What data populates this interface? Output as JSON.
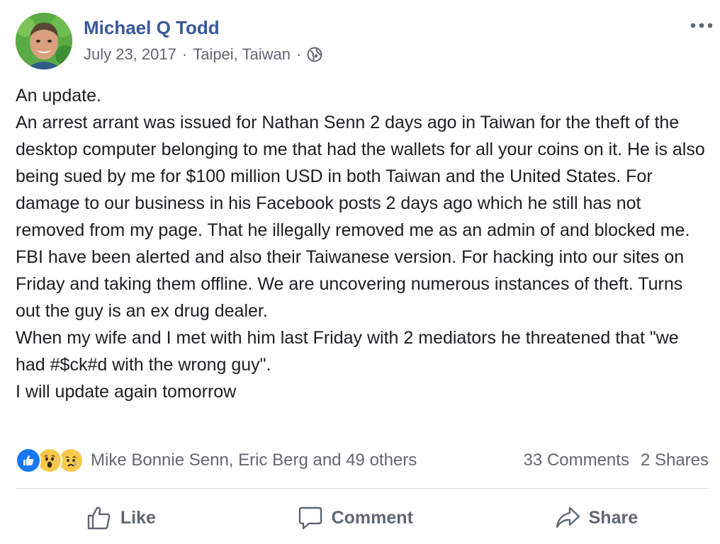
{
  "post": {
    "author": "Michael Q Todd",
    "date": "July 23, 2017",
    "location": "Taipei, Taiwan",
    "separator": "·",
    "icons": {
      "avatar": "profile-photo",
      "audience": "globe-icon",
      "menu": "more-options-icon"
    },
    "lines": [
      "An update.",
      "An arrest arrant was issued for Nathan Senn 2 days ago in Taiwan for the theft of the desktop computer belonging to me that had the wallets for all your coins on it. He is also being sued by me for $100 million USD in both Taiwan and the United States. For damage to our business in his Facebook posts 2 days ago which he still has not removed from my page. That he illegally removed me as an admin of and blocked me.",
      "FBI have been alerted and also their Taiwanese version. For hacking into our sites on Friday and taking them offline. We are uncovering numerous instances of theft. Turns out the guy is an ex drug dealer.",
      "When my wife and I met with him last Friday with 2 mediators he threatened that \"we had #$ck#d with the wrong guy\".",
      "I will update again tomorrow"
    ]
  },
  "reactions": {
    "icons": [
      "like-reaction-icon",
      "wow-reaction-icon",
      "sad-reaction-icon"
    ],
    "names": "Mike Bonnie Senn, Eric Berg and 49 others",
    "comments": "33 Comments",
    "shares": "2 Shares"
  },
  "actions": {
    "like": "Like",
    "comment": "Comment",
    "share": "Share"
  },
  "colors": {
    "author": "#385898",
    "meta": "#616770",
    "text": "#1c1e21",
    "like_blue": "#1877f2",
    "emoji_yellow": "#f7c84b",
    "divider": "#dadde1"
  }
}
